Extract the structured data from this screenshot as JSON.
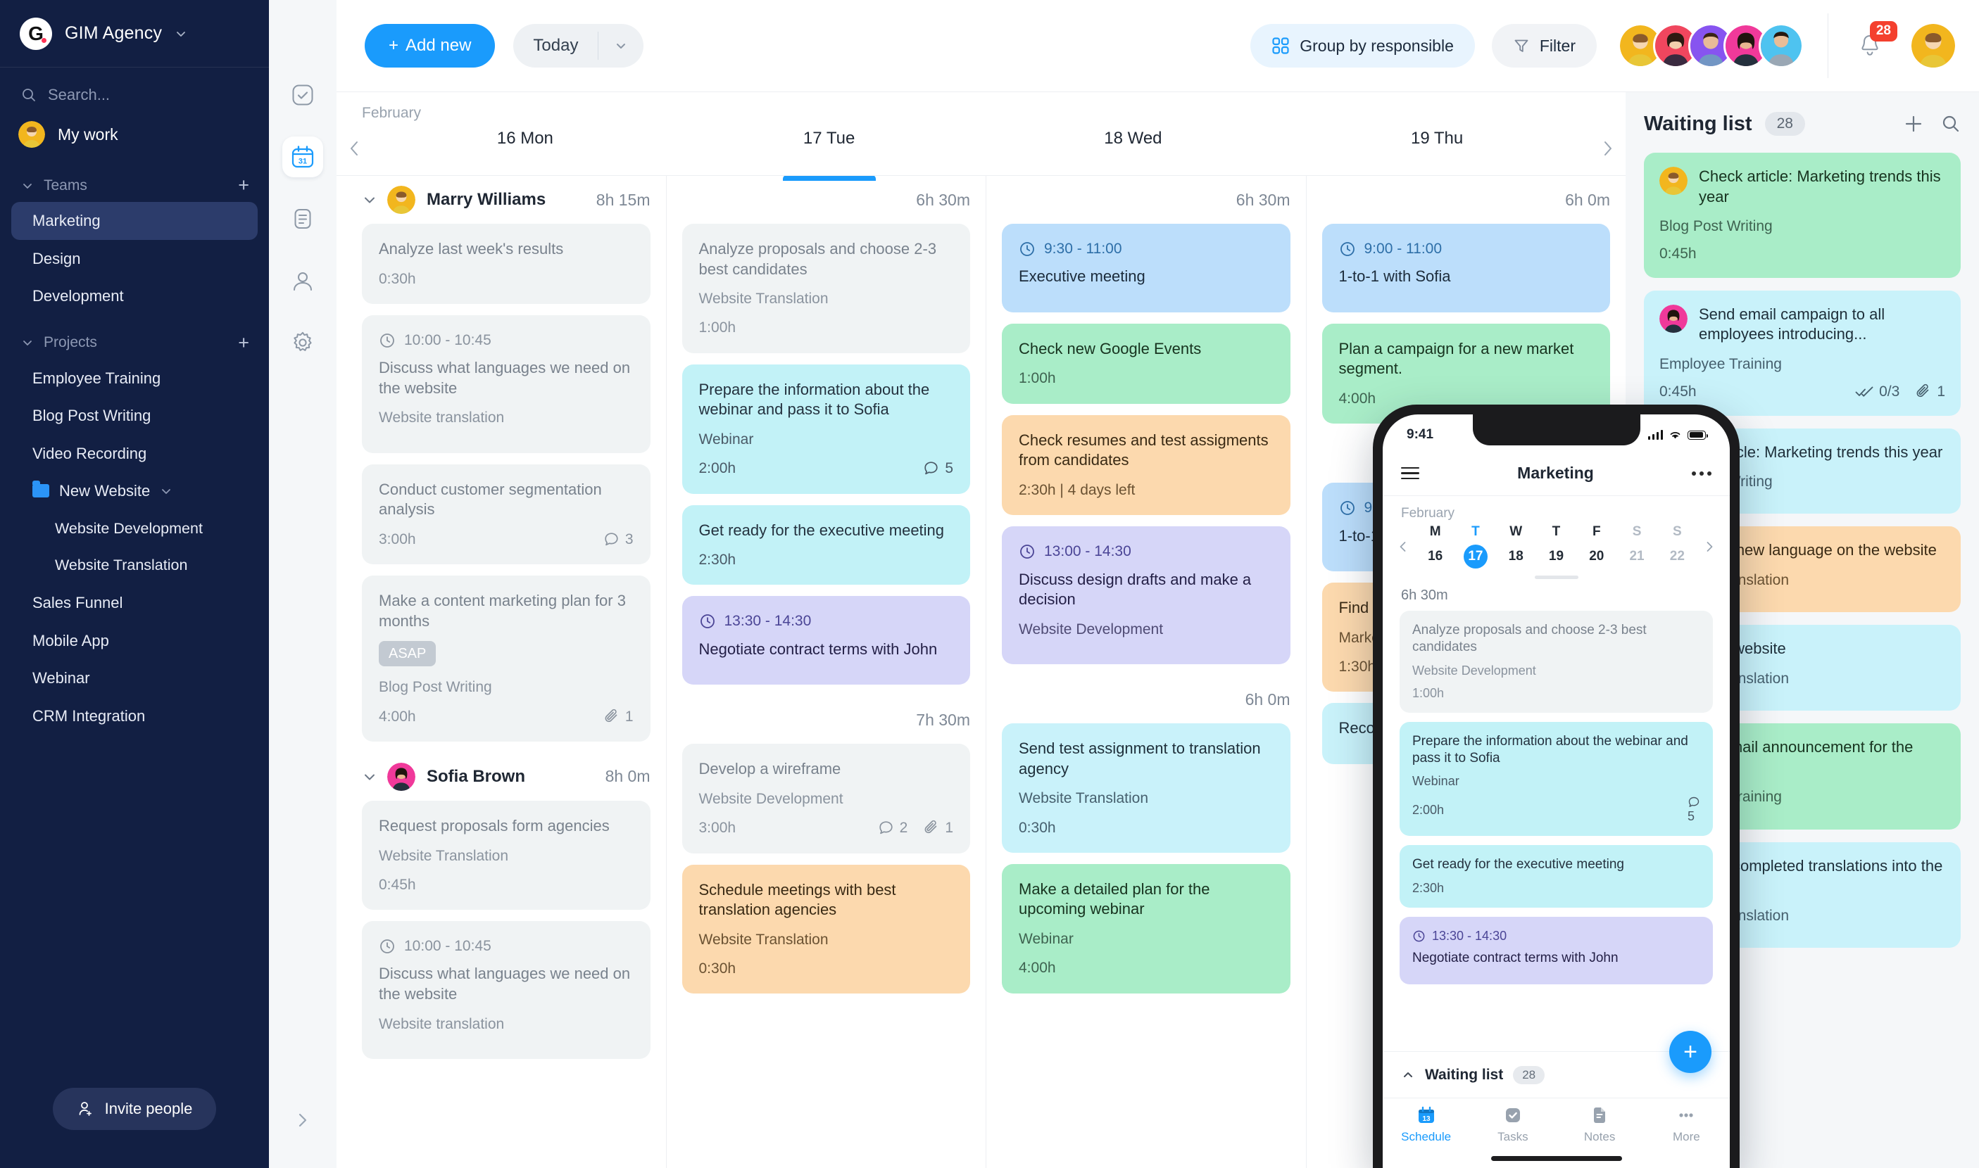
{
  "sidebar": {
    "brand": "GIM Agency",
    "search_placeholder": "Search...",
    "my_work": "My work",
    "teams_label": "Teams",
    "teams": [
      "Marketing",
      "Design",
      "Development"
    ],
    "projects_label": "Projects",
    "projects": [
      {
        "label": "Employee Training",
        "type": "item"
      },
      {
        "label": "Blog Post Writing",
        "type": "item"
      },
      {
        "label": "Video Recording",
        "type": "item"
      },
      {
        "label": "New Website",
        "type": "folder"
      },
      {
        "label": "Website Development",
        "type": "sub"
      },
      {
        "label": "Website Translation",
        "type": "sub"
      },
      {
        "label": "Sales Funnel",
        "type": "item"
      },
      {
        "label": "Mobile App",
        "type": "item"
      },
      {
        "label": "Webinar",
        "type": "item"
      },
      {
        "label": "CRM Integration",
        "type": "item"
      }
    ],
    "invite": "Invite people"
  },
  "rail": {
    "label": "Tools"
  },
  "topbar": {
    "add_new": "Add new",
    "today": "Today",
    "group_by": "Group by responsible",
    "filter": "Filter",
    "notifications_count": "28"
  },
  "calendar": {
    "month": "February",
    "days": [
      {
        "label": "16 Mon",
        "today": false
      },
      {
        "label": "17 Tue",
        "today": true
      },
      {
        "label": "18 Wed",
        "today": false
      },
      {
        "label": "19 Thu",
        "today": false
      }
    ]
  },
  "rows": [
    {
      "name": "Marry Williams",
      "total": "8h 15m",
      "day_totals": [
        "6h 30m",
        "6h 30m",
        "6h 0m"
      ],
      "columns": [
        [
          {
            "title": "Analyze last week's results",
            "duration": "0:30h",
            "color": "c-grey"
          },
          {
            "time": "10:00 - 10:45",
            "title": "Discuss what languages we need on the website",
            "project": "Website translation",
            "color": "c-grey"
          },
          {
            "title": "Conduct customer segmentation analysis",
            "duration": "3:00h",
            "comments": "3",
            "color": "c-grey"
          },
          {
            "title": "Make a content marketing plan for 3 months",
            "tag": "ASAP",
            "project": "Blog Post Writing",
            "duration": "4:00h",
            "attachments": "1",
            "color": "c-grey"
          }
        ],
        [
          {
            "title": "Analyze proposals and choose 2-3 best candidates",
            "project": "Website Translation",
            "duration": "1:00h",
            "color": "c-grey"
          },
          {
            "title": "Prepare the information about the webinar and pass it to Sofia",
            "project": "Webinar",
            "duration": "2:00h",
            "comments": "5",
            "color": "c-cyan"
          },
          {
            "title": "Get ready for the executive meeting",
            "duration": "2:30h",
            "color": "c-cyan"
          },
          {
            "time": "13:30 - 14:30",
            "title": "Negotiate contract terms with John",
            "color": "c-purple"
          }
        ],
        [
          {
            "time": "9:30 - 11:00",
            "title": "Executive meeting",
            "color": "c-blue"
          },
          {
            "title": "Check new Google Events",
            "duration": "1:00h",
            "color": "c-green"
          },
          {
            "title": "Check resumes and test assigments from candidates",
            "duration": "2:30h | 4 days left",
            "color": "c-orange"
          },
          {
            "time": "13:00 - 14:30",
            "title": "Discuss design drafts and make a decision",
            "project": "Website Development",
            "color": "c-purple"
          }
        ],
        [
          {
            "time": "9:00 - 11:00",
            "title": "1-to-1 with Sofia",
            "color": "c-blue"
          },
          {
            "title": "Plan a campaign for a new market segment.",
            "duration": "4:00h",
            "color": "c-green"
          }
        ]
      ]
    },
    {
      "name": "Sofia Brown",
      "total": "8h 0m",
      "day_totals": [
        "7h 30m",
        "6h 0m",
        ""
      ],
      "columns": [
        [
          {
            "title": "Request proposals form agencies",
            "project": "Website Translation",
            "duration": "0:45h",
            "color": "c-grey"
          },
          {
            "time": "10:00 - 10:45",
            "title": "Discuss what languages we need on the website",
            "project": "Website translation",
            "color": "c-grey"
          }
        ],
        [
          {
            "title": "Develop a wireframe",
            "project": "Website Development",
            "duration": "3:00h",
            "comments": "2",
            "attachments": "1",
            "color": "c-grey"
          },
          {
            "title": "Schedule meetings with best translation agencies",
            "project": "Website Translation",
            "duration": "0:30h",
            "color": "c-orange"
          }
        ],
        [
          {
            "title": "Send test assignment to translation agency",
            "project": "Website Translation",
            "duration": "0:30h",
            "color": "c-lcyan"
          },
          {
            "title": "Make a detailed plan for the upcoming webinar",
            "project": "Webinar",
            "duration": "4:00h",
            "color": "c-green"
          }
        ],
        [
          {
            "time": "9:00 - 11:00",
            "title": "1-to-1 with Sofia",
            "color": "c-blue"
          },
          {
            "title": "Find a comp",
            "project": "Marke",
            "duration": "1:30h",
            "color": "c-orange"
          },
          {
            "title": "Record ne",
            "color": "c-lcyan"
          }
        ]
      ]
    }
  ],
  "waiting": {
    "title": "Waiting list",
    "count": "28",
    "items": [
      {
        "title": "Check article: Marketing trends this year",
        "project": "Blog Post Writing",
        "duration": "0:45h",
        "color": "c-green",
        "avatar": "yellow"
      },
      {
        "title": "Send email campaign to all employees introducing...",
        "project": "Employee Training",
        "duration": "0:45h",
        "checklist": "0/3",
        "attachments": "1",
        "color": "c-lcyan",
        "avatar": "pink"
      },
      {
        "title": "Publish article: Marketing trends this year",
        "project": "Blog Post Writing",
        "color": "c-lcyan",
        "avatar": "none"
      },
      {
        "title": "Implement new language on the website",
        "project": "Website Translation",
        "color": "c-orange",
        "avatar": "none"
      },
      {
        "title": "Check the website",
        "project": "Website Translation",
        "color": "c-lcyan",
        "avatar": "none"
      },
      {
        "title": "Write an email announcement for the ne...",
        "project": "Employee Training",
        "color": "c-green",
        "avatar": "none"
      },
      {
        "title": "Upload all completed translations into the admin...",
        "project": "Website Translation",
        "color": "c-lcyan",
        "avatar": "none"
      }
    ]
  },
  "phone": {
    "status_time": "9:41",
    "title": "Marketing",
    "month": "February",
    "week": [
      {
        "dow": "M",
        "num": "16",
        "state": ""
      },
      {
        "dow": "T",
        "num": "17",
        "state": "sel"
      },
      {
        "dow": "W",
        "num": "18",
        "state": ""
      },
      {
        "dow": "T",
        "num": "19",
        "state": ""
      },
      {
        "dow": "F",
        "num": "20",
        "state": ""
      },
      {
        "dow": "S",
        "num": "21",
        "state": "dim"
      },
      {
        "dow": "S",
        "num": "22",
        "state": "dim"
      }
    ],
    "total": "6h 30m",
    "cards": [
      {
        "title": "Analyze proposals and choose 2-3 best candidates",
        "project": "Website Development",
        "duration": "1:00h",
        "color": "c-grey"
      },
      {
        "title": "Prepare the information about the webinar and pass it to Sofia",
        "project": "Webinar",
        "duration": "2:00h",
        "comments": "5",
        "color": "c-cyan"
      },
      {
        "title": "Get ready for the executive meeting",
        "duration": "2:30h",
        "color": "c-cyan"
      },
      {
        "time": "13:30 - 14:30",
        "title": "Negotiate contract terms with John",
        "color": "c-purple"
      }
    ],
    "waiting_label": "Waiting list",
    "waiting_count": "28",
    "tabs": [
      {
        "label": "Schedule",
        "icon": "calendar-icon",
        "active": true
      },
      {
        "label": "Tasks",
        "icon": "check-icon",
        "active": false
      },
      {
        "label": "Notes",
        "icon": "notes-icon",
        "active": false
      },
      {
        "label": "More",
        "icon": "more-icon",
        "active": false
      }
    ]
  },
  "colors": {
    "accent": "#1a9bfc",
    "sidebar_bg": "#121f43",
    "badge_red": "#f4402e"
  }
}
